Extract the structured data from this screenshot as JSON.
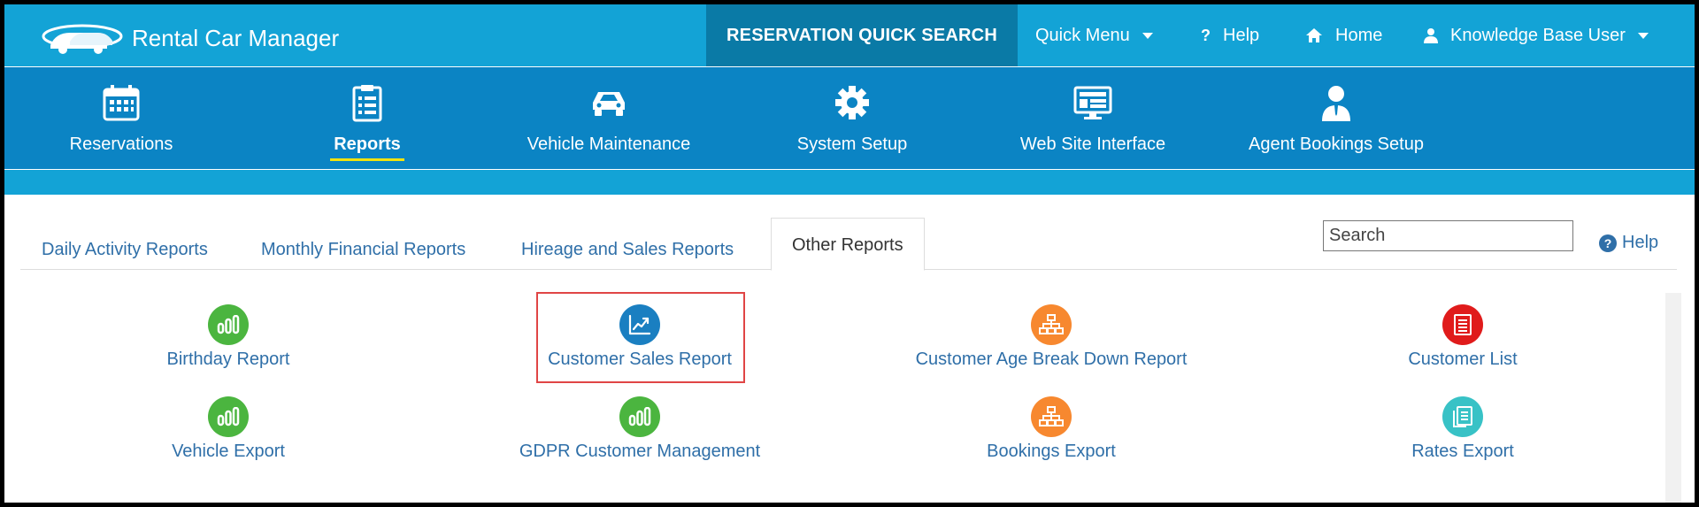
{
  "app": {
    "title": "Rental Car Manager"
  },
  "topbar": {
    "quick_search": "RESERVATION QUICK SEARCH",
    "quick_menu": "Quick Menu",
    "help": "Help",
    "home": "Home",
    "user": "Knowledge Base User"
  },
  "mainnav": {
    "items": [
      {
        "label": "Reservations",
        "icon": "calendar-icon"
      },
      {
        "label": "Reports",
        "icon": "clipboard-list-icon",
        "active": true
      },
      {
        "label": "Vehicle Maintenance",
        "icon": "car-icon"
      },
      {
        "label": "System Setup",
        "icon": "gear-icon"
      },
      {
        "label": "Web Site Interface",
        "icon": "monitor-icon"
      },
      {
        "label": "Agent Bookings Setup",
        "icon": "agent-icon"
      }
    ]
  },
  "tabs": {
    "items": [
      {
        "label": "Daily Activity Reports"
      },
      {
        "label": "Monthly Financial Reports"
      },
      {
        "label": "Hireage and Sales Reports"
      },
      {
        "label": "Other Reports",
        "active": true
      }
    ]
  },
  "search": {
    "placeholder": "Search"
  },
  "help_link": {
    "label": "Help"
  },
  "reports": {
    "items": [
      {
        "label": "Birthday Report",
        "icon": "bar-chart-icon",
        "color": "#4bb53f"
      },
      {
        "label": "Customer Sales Report",
        "icon": "trend-chart-icon",
        "color": "#1a7fc1",
        "highlighted": true
      },
      {
        "label": "Customer Age Break Down Report",
        "icon": "org-chart-icon",
        "color": "#f7882f"
      },
      {
        "label": "Customer List",
        "icon": "document-icon",
        "color": "#e01b1b"
      },
      {
        "label": "Vehicle Export",
        "icon": "bar-chart-icon",
        "color": "#4bb53f"
      },
      {
        "label": "GDPR Customer Management",
        "icon": "bar-chart-icon",
        "color": "#4bb53f"
      },
      {
        "label": "Bookings Export",
        "icon": "org-chart-icon",
        "color": "#f7882f"
      },
      {
        "label": "Rates Export",
        "icon": "documents-icon",
        "color": "#38c2c6"
      }
    ]
  },
  "colors": {
    "topbar": "#13a3d6",
    "mainnav": "#0b84c4",
    "quick_search_bg": "#0a7aa6",
    "link": "#2f6fa8",
    "active_underline": "#f2e20f",
    "highlight": "#e04545"
  }
}
